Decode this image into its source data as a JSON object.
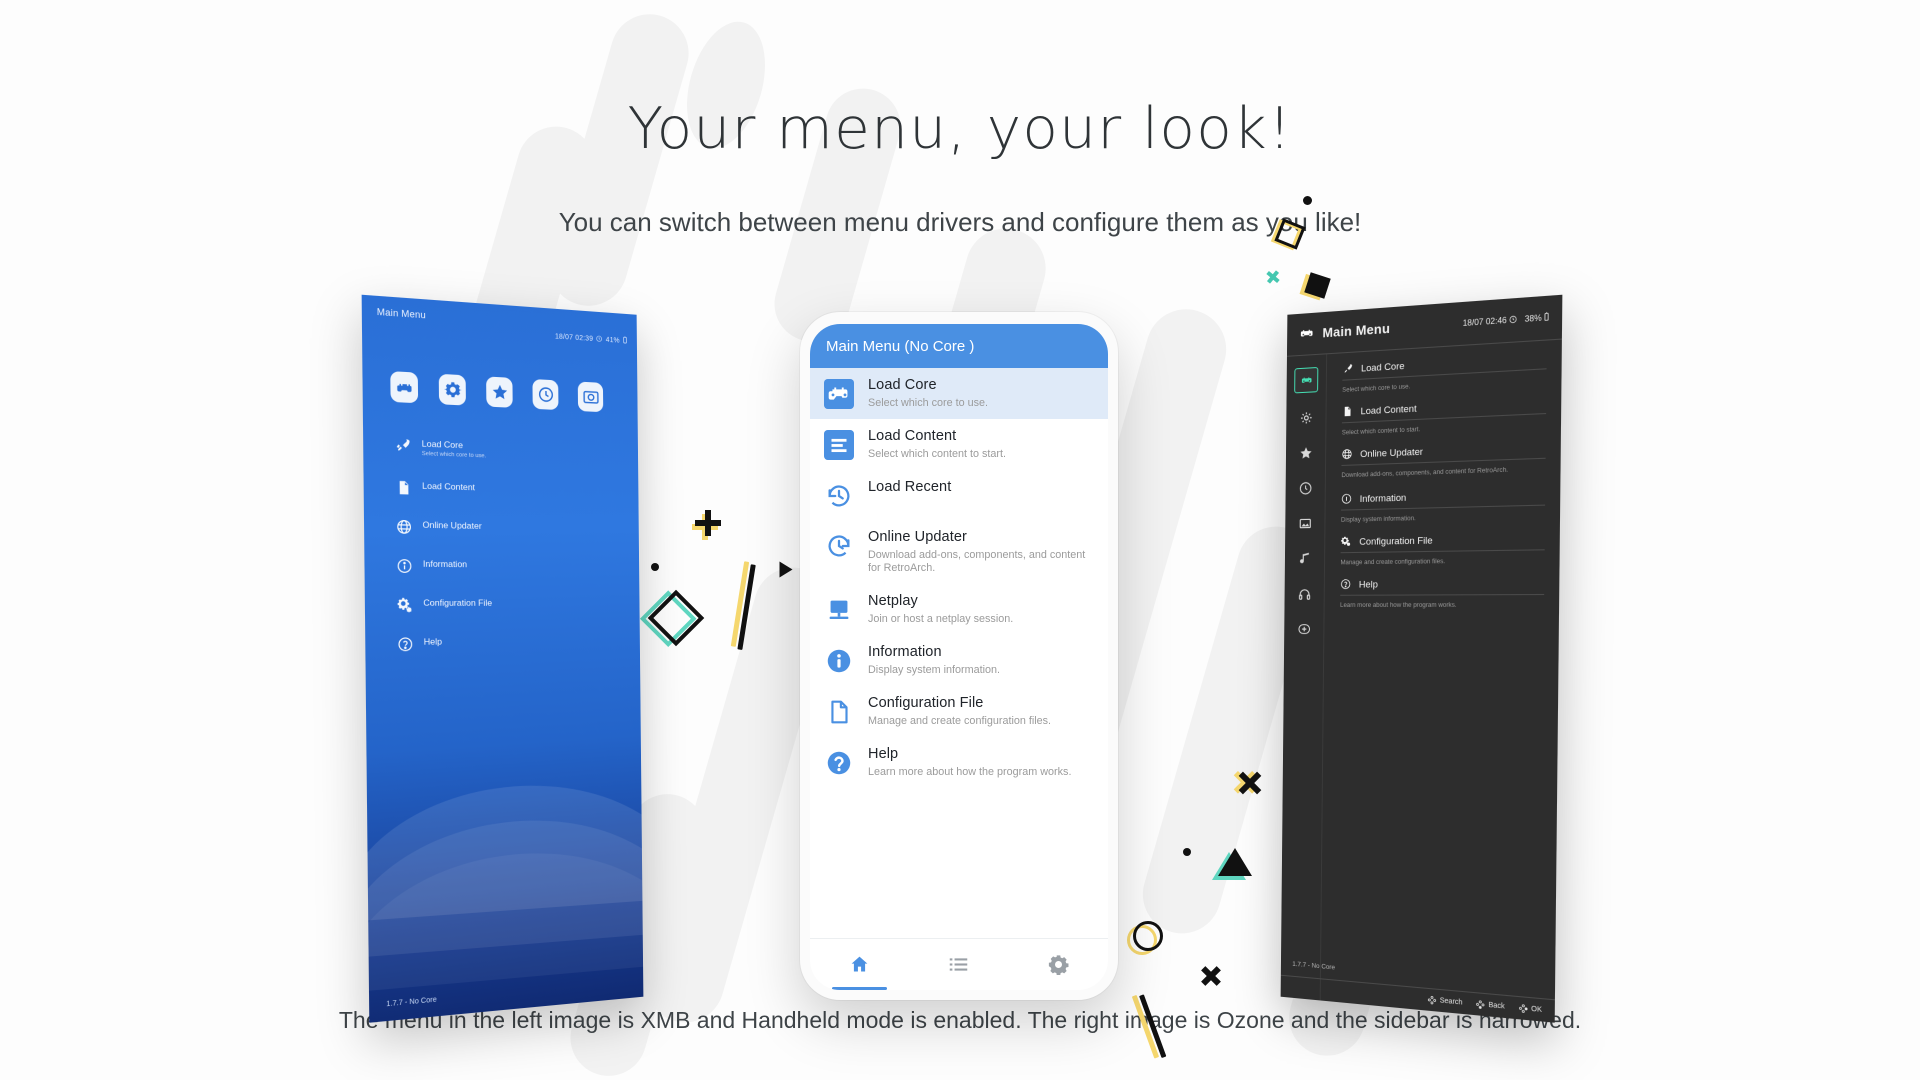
{
  "page": {
    "title": "Your menu, your look!",
    "subtitle": "You can switch between menu drivers and configure them as you like!",
    "caption": "The menu in the left image is XMB and Handheld mode is enabled. The right image is Ozone and the sidebar is narrowed."
  },
  "colors": {
    "xmb_blue": "#2a6fd6",
    "phone_accent": "#4a90e2",
    "ozone_bg": "#2d2d2d",
    "ozone_highlight": "#45e0b4",
    "deco_yellow": "#f5d76e",
    "deco_teal": "#5fd6c0",
    "deco_black": "#111111"
  },
  "xmb": {
    "header_title": "Main Menu",
    "status": {
      "datetime": "18/07 02:39",
      "clock_icon": "clock-icon",
      "battery": "41%",
      "battery_icon": "battery-icon"
    },
    "tabs": [
      {
        "name": "main-menu-tab",
        "icon": "retroarch-icon"
      },
      {
        "name": "settings-tab",
        "icon": "gear-icon"
      },
      {
        "name": "favorites-tab",
        "icon": "star-icon"
      },
      {
        "name": "history-tab",
        "icon": "clock-icon"
      },
      {
        "name": "images-tab",
        "icon": "image-icon"
      }
    ],
    "items": [
      {
        "label": "Load Core",
        "sublabel": "Select which core to use.",
        "icon": "rocket-icon"
      },
      {
        "label": "Load Content",
        "sublabel": "",
        "icon": "file-icon"
      },
      {
        "label": "Online Updater",
        "sublabel": "",
        "icon": "globe-icon"
      },
      {
        "label": "Information",
        "sublabel": "",
        "icon": "info-icon"
      },
      {
        "label": "Configuration File",
        "sublabel": "",
        "icon": "gears-icon"
      },
      {
        "label": "Help",
        "sublabel": "",
        "icon": "help-icon"
      }
    ],
    "version": "1.7.7 - No Core"
  },
  "phone": {
    "appbar_title": "Main Menu (No Core )",
    "items": [
      {
        "label": "Load Core",
        "sublabel": "Select which core to use.",
        "icon": "retroarch-icon",
        "selected": true
      },
      {
        "label": "Load Content",
        "sublabel": "Select which content to start.",
        "icon": "list-icon",
        "selected": false
      },
      {
        "label": "Load Recent",
        "sublabel": "",
        "icon": "history-icon",
        "selected": false
      },
      {
        "label": "Online Updater",
        "sublabel": "Download add-ons, components, and content for RetroArch.",
        "icon": "update-icon",
        "selected": false
      },
      {
        "label": "Netplay",
        "sublabel": "Join or host a netplay session.",
        "icon": "netplay-icon",
        "selected": false
      },
      {
        "label": "Information",
        "sublabel": "Display system information.",
        "icon": "info-icon",
        "selected": false
      },
      {
        "label": "Configuration File",
        "sublabel": "Manage and create configuration files.",
        "icon": "document-icon",
        "selected": false
      },
      {
        "label": "Help",
        "sublabel": "Learn more about how the program works.",
        "icon": "help-icon",
        "selected": false
      }
    ],
    "tabs": [
      {
        "name": "home-tab",
        "icon": "home-icon",
        "active": true
      },
      {
        "name": "playlists-tab",
        "icon": "list-icon",
        "active": false
      },
      {
        "name": "settings-tab",
        "icon": "gear-icon",
        "active": false
      }
    ]
  },
  "ozone": {
    "header_title": "Main Menu",
    "header_icon": "retroarch-icon",
    "status": {
      "datetime": "18/07 02:46",
      "clock_icon": "clock-icon",
      "battery": "38%",
      "battery_icon": "battery-icon"
    },
    "sidebar": [
      {
        "name": "sidebar-main-menu",
        "icon": "retroarch-icon",
        "active": true
      },
      {
        "name": "sidebar-settings",
        "icon": "gear-icon",
        "active": false
      },
      {
        "name": "sidebar-favorites",
        "icon": "star-icon",
        "active": false
      },
      {
        "name": "sidebar-history",
        "icon": "clock-icon",
        "active": false
      },
      {
        "name": "sidebar-images",
        "icon": "image-icon",
        "active": false
      },
      {
        "name": "sidebar-music",
        "icon": "music-icon",
        "active": false
      },
      {
        "name": "sidebar-video",
        "icon": "headphone-icon",
        "active": false
      },
      {
        "name": "sidebar-add",
        "icon": "plus-circle-icon",
        "active": false
      }
    ],
    "items": [
      {
        "label": "Load Core",
        "sublabel": "Select which core to use.",
        "icon": "rocket-icon"
      },
      {
        "label": "Load Content",
        "sublabel": "Select which content to start.",
        "icon": "file-icon"
      },
      {
        "label": "Online Updater",
        "sublabel": "Download add-ons, components, and content for RetroArch.",
        "icon": "globe-icon"
      },
      {
        "label": "Information",
        "sublabel": "Display system information.",
        "icon": "info-icon"
      },
      {
        "label": "Configuration File",
        "sublabel": "Manage and create configuration files.",
        "icon": "gears-icon"
      },
      {
        "label": "Help",
        "sublabel": "Learn more about how the program works.",
        "icon": "help-icon"
      }
    ],
    "version": "1.7.7 - No Core",
    "footer": [
      {
        "label": "Search",
        "icon": "dpad-icon"
      },
      {
        "label": "Back",
        "icon": "dpad-icon"
      },
      {
        "label": "OK",
        "icon": "dpad-icon"
      }
    ]
  }
}
